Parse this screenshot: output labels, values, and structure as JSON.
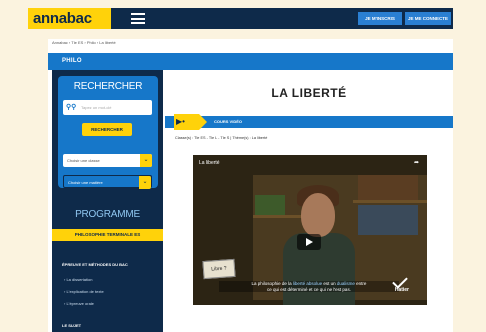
{
  "header": {
    "logo": "annabac",
    "signup": "JE M'INSCRIS",
    "login": "JE ME CONNECTE"
  },
  "breadcrumb": "Annabac › Tle ES › Philo › La liberté",
  "section_bar": "PHILO",
  "sidebar": {
    "search_title": "RECHERCHER",
    "search_placeholder": "Tapez un mot-clé",
    "search_button": "RECHERCHER",
    "select_class": "Choisir une classe",
    "select_subject": "Choisir une matière",
    "program_title": "PROGRAMME",
    "program_bar": "PHILOSOPHIE TERMINALE ES",
    "section_epreuve": "ÉPREUVE ET MÉTHODES DU BAC",
    "links": [
      "La dissertation",
      "L'explication de texte",
      "L'épreuve orale"
    ],
    "section_sujet": "LE SUJET"
  },
  "main": {
    "title": "LA LIBERTÉ",
    "cours_label": "COURS VIDÉO",
    "meta": "Classe(s) : Tle ES - Tle L - Tle S   |   Thème(s) : La liberté"
  },
  "video": {
    "title": "La liberté",
    "book_label": "Libre ?",
    "subtitle_line1_pre": "La philosophie de la ",
    "subtitle_hl1": "liberté",
    "subtitle_line1_mid": " ",
    "subtitle_hl2": "absolue",
    "subtitle_line1_mid2": " est un ",
    "subtitle_hl3": "dualisme",
    "subtitle_line1_post": " entre",
    "subtitle_line2": "ce qui est déterminé et ce qui ne l'est pas.",
    "brand": "Hatier"
  },
  "colors": {
    "navy": "#0e2a4a",
    "blue": "#1677c9",
    "yellow": "#ffd20a",
    "cream": "#fbf3df"
  }
}
